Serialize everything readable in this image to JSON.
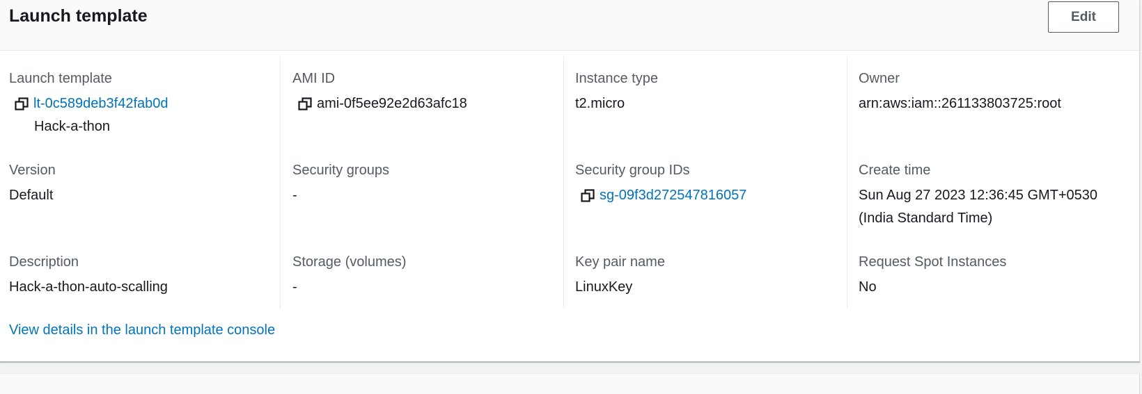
{
  "header": {
    "title": "Launch template",
    "edit_label": "Edit"
  },
  "fields": {
    "launch_template": {
      "label": "Launch template",
      "id": "lt-0c589deb3f42fab0d",
      "name": "Hack-a-thon"
    },
    "ami_id": {
      "label": "AMI ID",
      "value": "ami-0f5ee92e2d63afc18"
    },
    "instance_type": {
      "label": "Instance type",
      "value": "t2.micro"
    },
    "owner": {
      "label": "Owner",
      "value": "arn:aws:iam::261133803725:root"
    },
    "version": {
      "label": "Version",
      "value": "Default"
    },
    "security_groups": {
      "label": "Security groups",
      "value": "-"
    },
    "security_group_ids": {
      "label": "Security group IDs",
      "value": "sg-09f3d272547816057"
    },
    "create_time": {
      "label": "Create time",
      "value": "Sun Aug 27 2023 12:36:45 GMT+0530 (India Standard Time)"
    },
    "description": {
      "label": "Description",
      "value": "Hack-a-thon-auto-scalling"
    },
    "storage": {
      "label": "Storage (volumes)",
      "value": "-"
    },
    "key_pair": {
      "label": "Key pair name",
      "value": "LinuxKey"
    },
    "request_spot": {
      "label": "Request Spot Instances",
      "value": "No"
    }
  },
  "footer": {
    "link_label": "View details in the launch template console"
  },
  "colors": {
    "link": "#0073bb",
    "label": "#545b64",
    "text": "#16191f"
  },
  "icons": {
    "copy": "copy-icon"
  }
}
